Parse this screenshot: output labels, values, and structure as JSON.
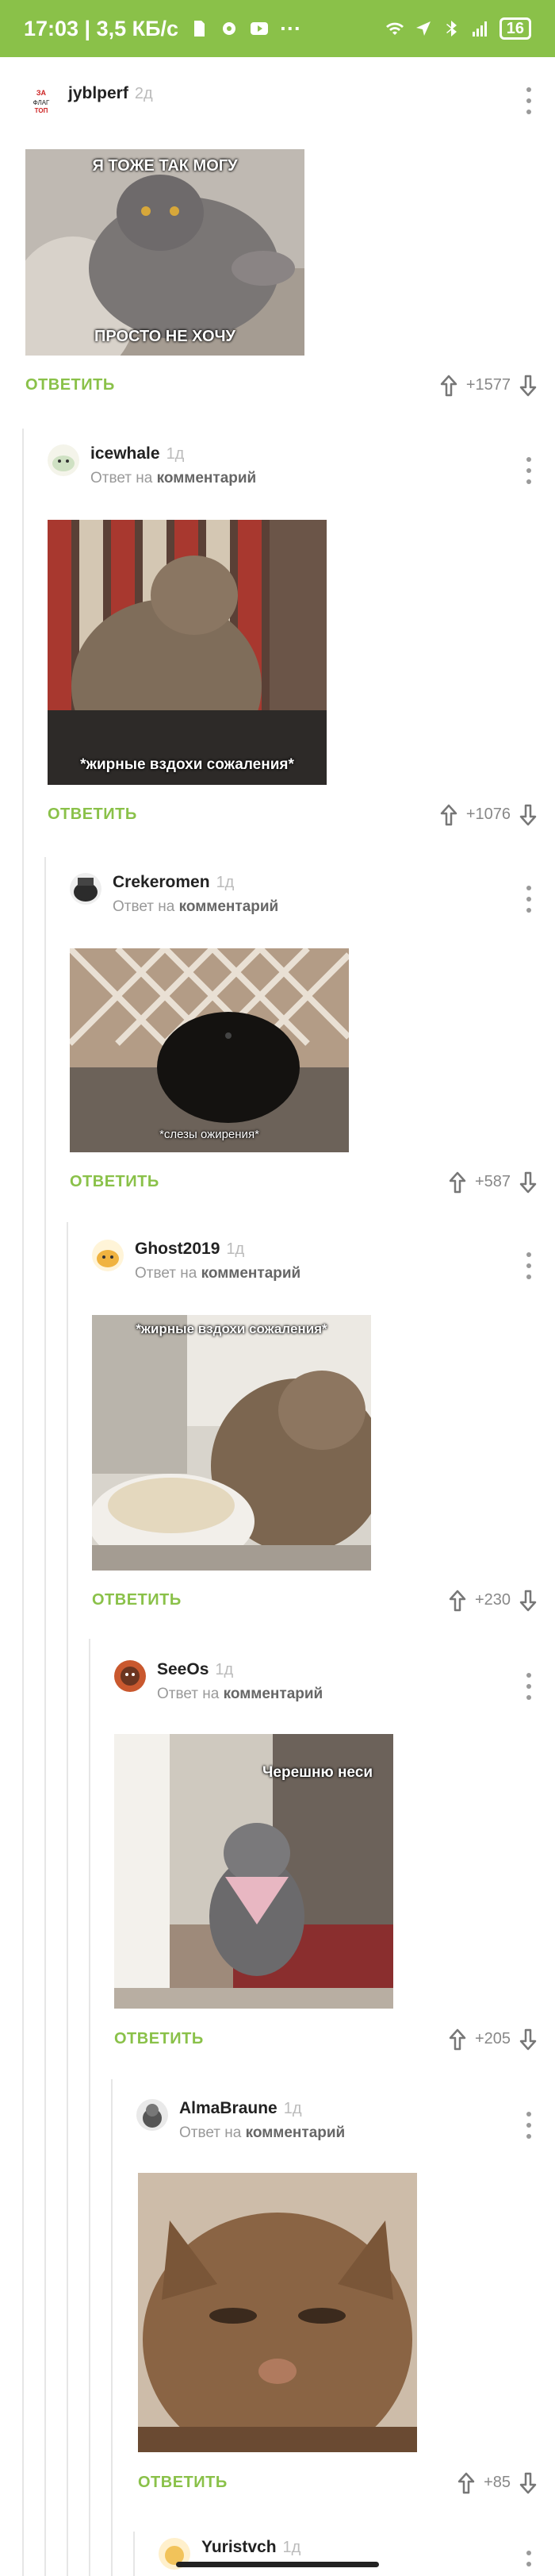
{
  "status_bar": {
    "time_speed": "17:03 | 3,5 КБ/с",
    "more": "···",
    "battery": "16"
  },
  "colors": {
    "accent": "#8ac149",
    "vote_text": "#888888",
    "muted": "#999999"
  },
  "comments": [
    {
      "author": "jyblperf",
      "age": "2д",
      "image_top_text": "Я ТОЖЕ ТАК МОГУ",
      "image_bottom_text": "ПРОСТО НЕ ХОЧУ",
      "reply_label": "ОТВЕТИТЬ",
      "rating": "+1577"
    },
    {
      "author": "icewhale",
      "age": "1д",
      "reply_prefix": "Ответ на",
      "reply_target": "комментарий",
      "image_bottom_text": "*жирные вздохи сожаления*",
      "reply_label": "ОТВЕТИТЬ",
      "rating": "+1076"
    },
    {
      "author": "Crekeromen",
      "age": "1д",
      "reply_prefix": "Ответ на",
      "reply_target": "комментарий",
      "image_bottom_text": "*слезы ожирения*",
      "reply_label": "ОТВЕТИТЬ",
      "rating": "+587"
    },
    {
      "author": "Ghost2019",
      "age": "1д",
      "reply_prefix": "Ответ на",
      "reply_target": "комментарий",
      "image_top_text": "*жирные вздохи сожаления*",
      "reply_label": "ОТВЕТИТЬ",
      "rating": "+230"
    },
    {
      "author": "SeeOs",
      "age": "1д",
      "reply_prefix": "Ответ на",
      "reply_target": "комментарий",
      "image_top_text": "Черешню неси",
      "reply_label": "ОТВЕТИТЬ",
      "rating": "+205"
    },
    {
      "author": "AlmaBraune",
      "age": "1д",
      "reply_prefix": "Ответ на",
      "reply_target": "комментарий",
      "reply_label": "ОТВЕТИТЬ",
      "rating": "+85"
    },
    {
      "author": "Yuristvch",
      "age": "1д"
    }
  ]
}
